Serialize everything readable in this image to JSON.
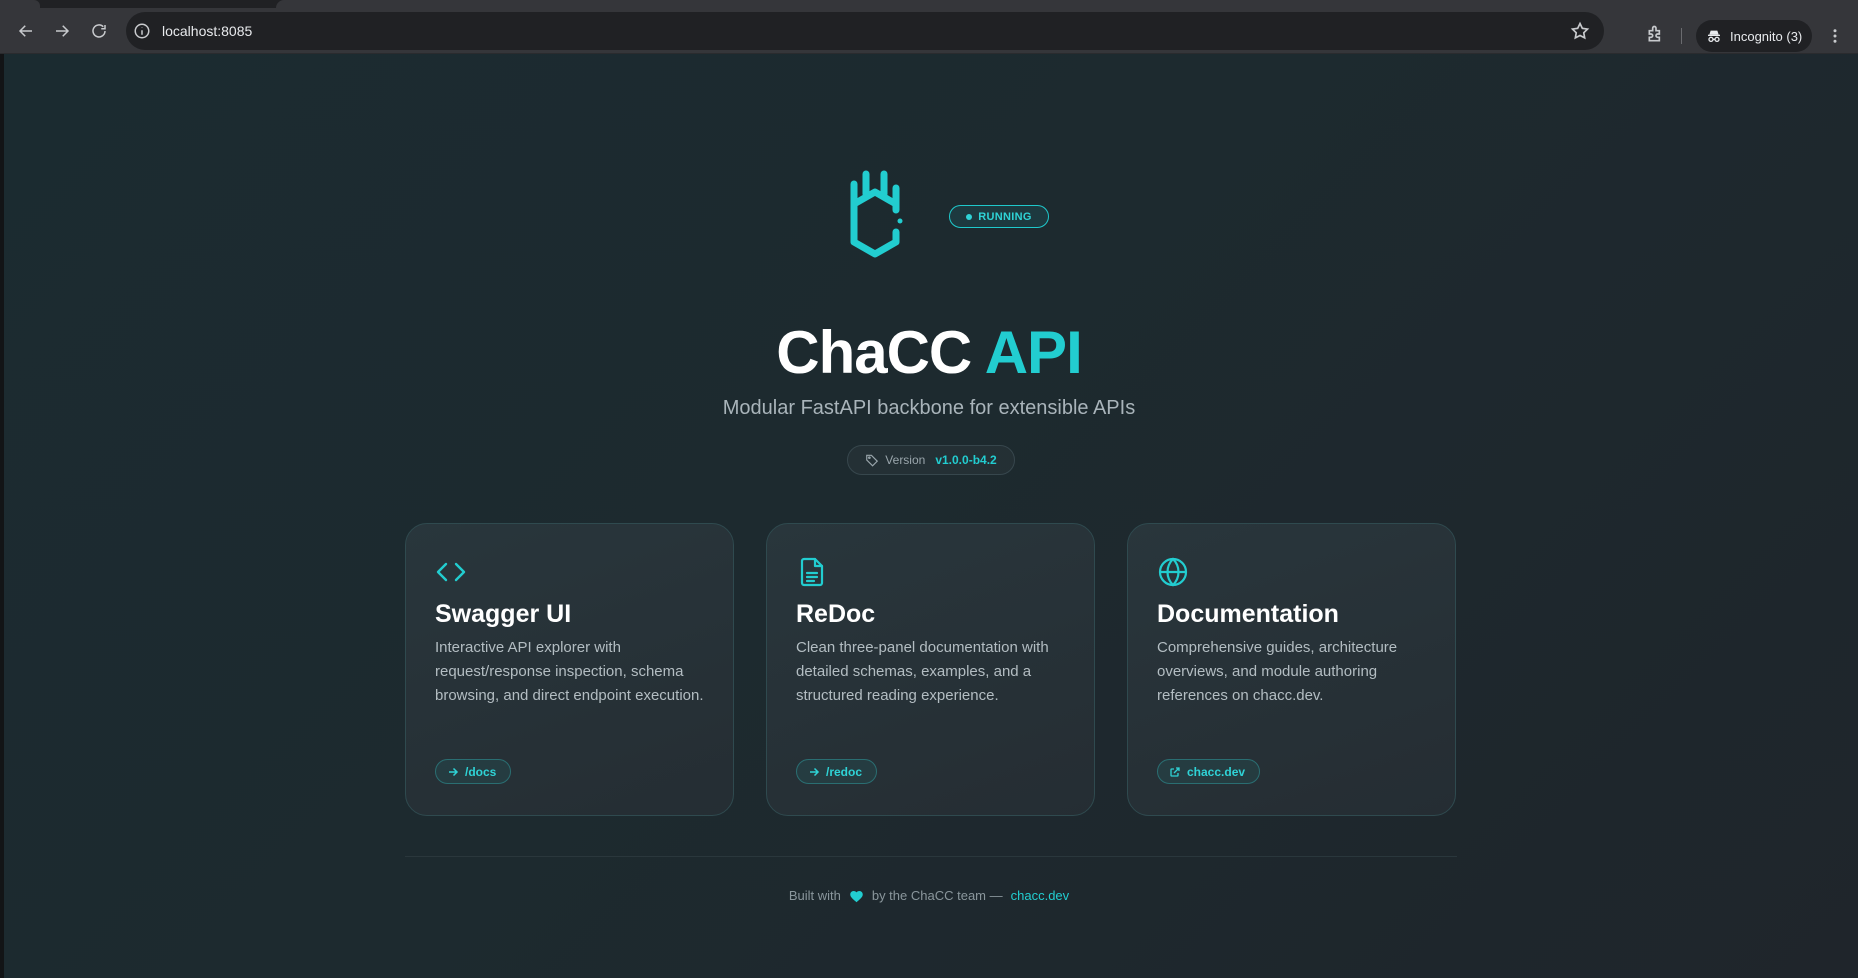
{
  "browser": {
    "url": "localhost:8085",
    "incognito_label": "Incognito (3)"
  },
  "hero": {
    "status": "RUNNING",
    "title_main": "ChaCC",
    "title_accent": "API",
    "subtitle": "Modular FastAPI backbone for extensible APIs",
    "version_label": "Version",
    "version_value": "v1.0.0-b4.2"
  },
  "cards": [
    {
      "icon": "code-icon",
      "title": "Swagger UI",
      "description": "Interactive API explorer with request/response inspection, schema browsing, and direct endpoint execution.",
      "link": "/docs"
    },
    {
      "icon": "document-icon",
      "title": "ReDoc",
      "description": "Clean three-panel documentation with detailed schemas, examples, and a structured reading experience.",
      "link": "/redoc"
    },
    {
      "icon": "globe-icon",
      "title": "Documentation",
      "description": "Comprehensive guides, architecture overviews, and module authoring references on chacc.dev.",
      "link": "chacc.dev"
    }
  ],
  "footer": {
    "built_with": "Built with",
    "by_team": "by the ChaCC team —",
    "link": "chacc.dev"
  },
  "colors": {
    "accent": "#22cdd0",
    "background": "#1d2a2f"
  }
}
